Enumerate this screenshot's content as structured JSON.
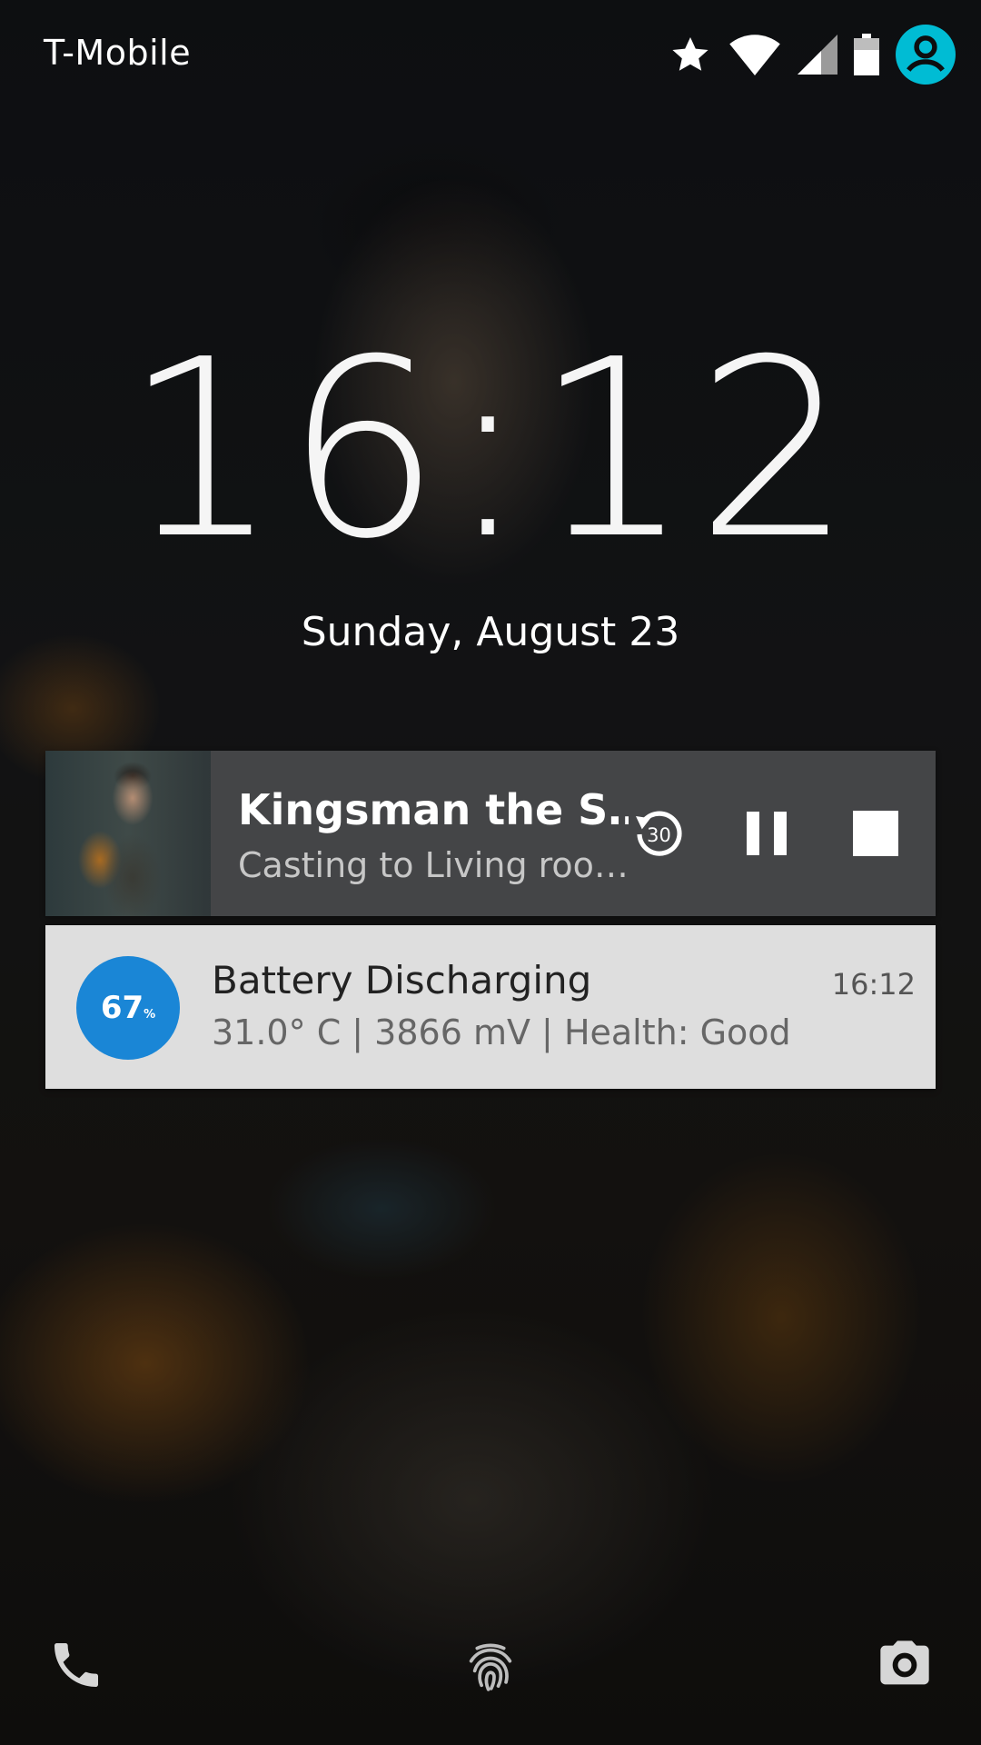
{
  "status_bar": {
    "carrier": "T-Mobile",
    "icons": [
      "star-icon",
      "wifi-icon",
      "cell-signal-icon",
      "battery-icon",
      "user-avatar-icon"
    ],
    "accent_color": "#00bcd4"
  },
  "lockscreen": {
    "time": "16:12",
    "date": "Sunday, August 23"
  },
  "media_notification": {
    "title": "Kingsman the S…",
    "subtitle": "Casting to Living roo…",
    "replay_seconds": "30",
    "controls": [
      "replay-30-icon",
      "pause-icon",
      "stop-icon"
    ]
  },
  "battery_notification": {
    "level": "67",
    "level_unit": "%",
    "title": "Battery Discharging",
    "time": "16:12",
    "detail": "31.0° C | 3866 mV | Health: Good",
    "badge_color": "#1a86d6"
  },
  "bottom_shortcuts": [
    "phone-icon",
    "fingerprint-icon",
    "camera-icon"
  ]
}
